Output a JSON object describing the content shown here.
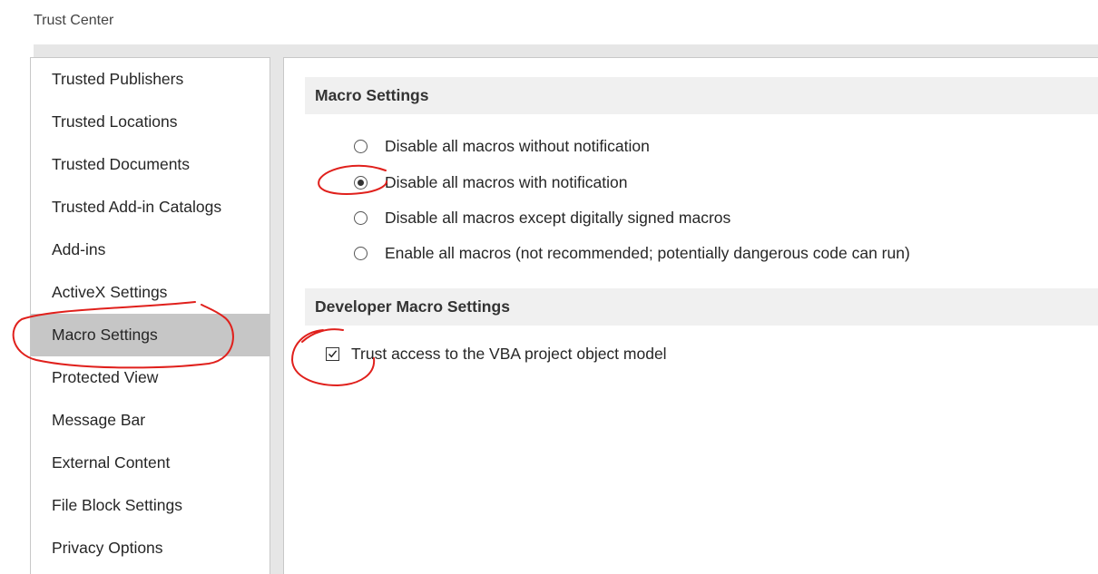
{
  "window": {
    "title": "Trust Center"
  },
  "sidebar": {
    "selected": "Macro Settings",
    "items": [
      {
        "label": "Trusted Publishers"
      },
      {
        "label": "Trusted Locations"
      },
      {
        "label": "Trusted Documents"
      },
      {
        "label": "Trusted Add-in Catalogs"
      },
      {
        "label": "Add-ins"
      },
      {
        "label": "ActiveX Settings"
      },
      {
        "label": "Macro Settings"
      },
      {
        "label": "Protected View"
      },
      {
        "label": "Message Bar"
      },
      {
        "label": "External Content"
      },
      {
        "label": "File Block Settings"
      },
      {
        "label": "Privacy Options"
      }
    ]
  },
  "macro_settings": {
    "header": "Macro Settings",
    "selected_index": 1,
    "options": [
      {
        "label": "Disable all macros without notification",
        "checked": false
      },
      {
        "label": "Disable all macros with notification",
        "checked": true
      },
      {
        "label": "Disable all macros except digitally signed macros",
        "checked": false
      },
      {
        "label": "Enable all macros (not recommended; potentially dangerous code can run)",
        "checked": false
      }
    ]
  },
  "developer_settings": {
    "header": "Developer Macro Settings",
    "trust_vba": {
      "label": "Trust access to the VBA project object model",
      "checked": true
    }
  },
  "colors": {
    "selected_item_bg": "#c6c6c6",
    "section_header_bg": "#f0f0f0",
    "annotation": "#e0201c"
  }
}
